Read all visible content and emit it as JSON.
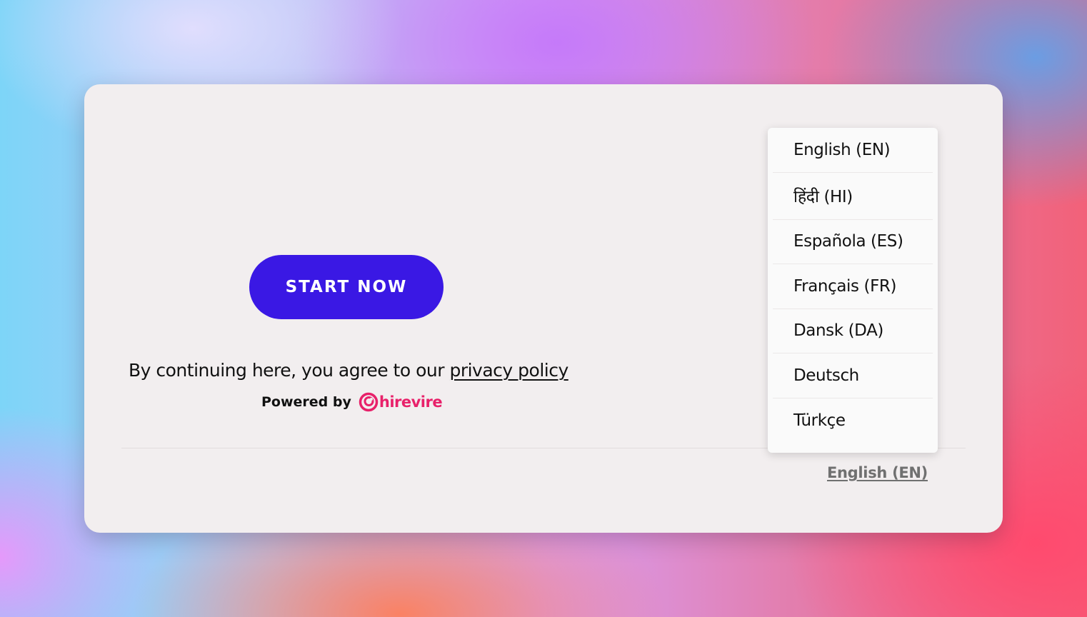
{
  "start_button": {
    "label": "START NOW"
  },
  "consent": {
    "prefix": "By continuing here, you agree to our ",
    "link_text": "privacy policy"
  },
  "powered_by": {
    "label": "Powered by",
    "brand": "hirevire",
    "brand_color": "#e8216a"
  },
  "language_menu": {
    "items": [
      {
        "label": "English (EN)"
      },
      {
        "label": "हिंदी (HI)"
      },
      {
        "label": "Española (ES)"
      },
      {
        "label": "Français (FR)"
      },
      {
        "label": "Dansk (DA)"
      },
      {
        "label": "Deutsch"
      },
      {
        "label": "Türkçe"
      }
    ]
  },
  "language_selector": {
    "current": "English (EN)"
  },
  "colors": {
    "accent": "#3a18e4",
    "card_background": "#f2eeef"
  }
}
